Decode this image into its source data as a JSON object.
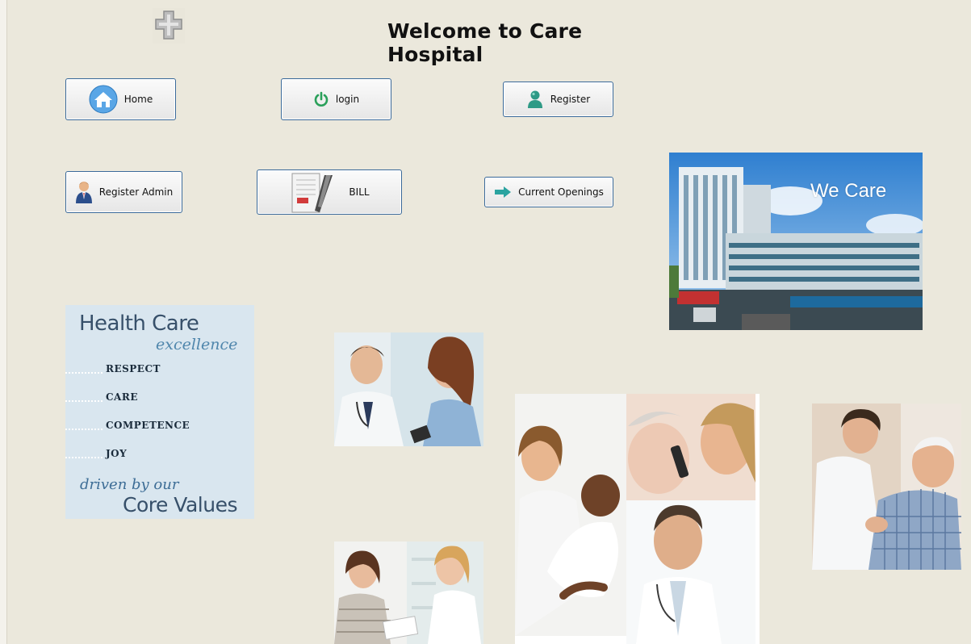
{
  "header": {
    "title": "Welcome to Care Hospital"
  },
  "logo": {
    "icon": "hospital-cross-icon"
  },
  "nav": {
    "home": {
      "label": "Home",
      "icon": "home-icon"
    },
    "login": {
      "label": "login",
      "icon": "power-icon"
    },
    "register": {
      "label": "Register",
      "icon": "user-icon"
    },
    "register_admin": {
      "label": "Register Admin",
      "icon": "admin-user-icon"
    },
    "bill": {
      "label": "BILL",
      "icon": "bill-pen-icon"
    },
    "current_openings": {
      "label": "Current Openings",
      "icon": "arrow-right-icon"
    }
  },
  "banner": {
    "caption": "We Care"
  },
  "core_values": {
    "heading": "Health Care",
    "subheading": "excellence",
    "values": [
      "RESPECT",
      "CARE",
      "COMPETENCE",
      "JOY"
    ],
    "driven": "driven by our",
    "footer": "Core Values"
  },
  "colors": {
    "background": "#ebe8dc",
    "button_border": "#3b6a9a",
    "core_panel": "#d9e6ef",
    "accent_blue": "#4f86ac"
  }
}
